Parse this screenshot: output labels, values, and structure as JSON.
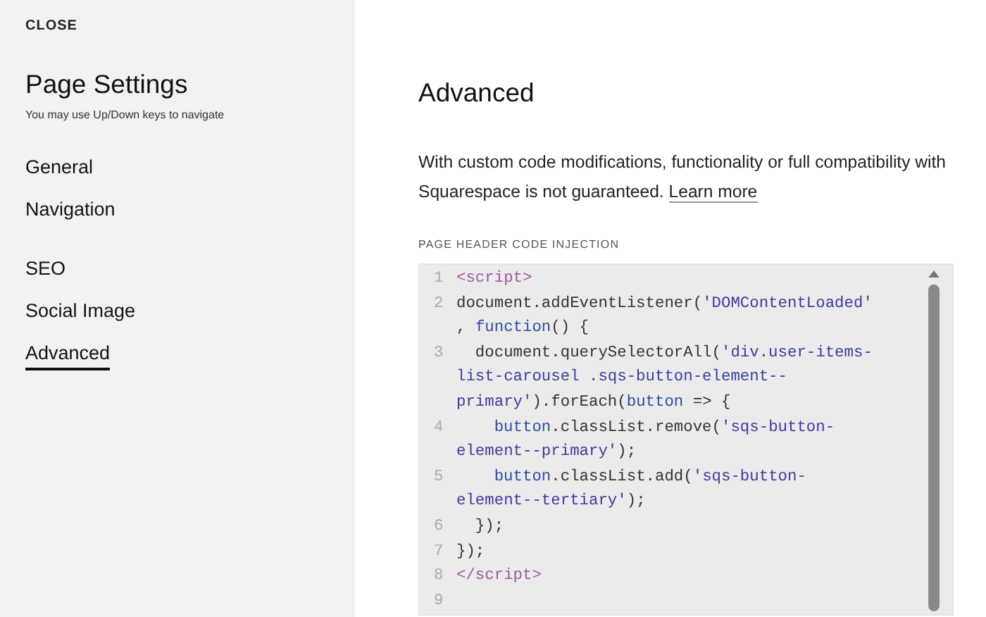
{
  "sidebar": {
    "close": "CLOSE",
    "title": "Page Settings",
    "hint": "You may use Up/Down keys to navigate",
    "groups": [
      [
        {
          "label": "General",
          "selected": false
        },
        {
          "label": "Navigation",
          "selected": false
        }
      ],
      [
        {
          "label": "SEO",
          "selected": false
        },
        {
          "label": "Social Image",
          "selected": false
        },
        {
          "label": "Advanced",
          "selected": true
        }
      ]
    ]
  },
  "main": {
    "title": "Advanced",
    "notice": "With custom code modifications, functionality or full compatibility with Squarespace is not guaranteed.",
    "link": "Learn more",
    "section_label": "PAGE HEADER CODE INJECTION",
    "code": [
      {
        "number": "1",
        "rows": [
          {
            "parts": [
              {
                "kind": "tag",
                "text": "<script>"
              }
            ]
          }
        ]
      },
      {
        "number": "2",
        "rows": [
          {
            "parts": [
              {
                "kind": "plain",
                "text": "document.addEventListener("
              },
              {
                "kind": "string",
                "text": "'DOMContentLoaded'"
              }
            ]
          },
          {
            "parts": [
              {
                "kind": "plain",
                "text": ", "
              },
              {
                "kind": "keyword",
                "text": "function"
              },
              {
                "kind": "plain",
                "text": "() {"
              }
            ]
          }
        ]
      },
      {
        "number": "3",
        "rows": [
          {
            "parts": [
              {
                "kind": "plain",
                "text": "  document.querySelectorAll("
              },
              {
                "kind": "string",
                "text": "'div.user-items-"
              }
            ]
          },
          {
            "parts": [
              {
                "kind": "string",
                "text": "list-carousel .sqs-button-element--"
              }
            ]
          },
          {
            "parts": [
              {
                "kind": "string",
                "text": "primary'"
              },
              {
                "kind": "plain",
                "text": ").forEach("
              },
              {
                "kind": "keyword",
                "text": "button"
              },
              {
                "kind": "plain",
                "text": " => {"
              }
            ]
          }
        ]
      },
      {
        "number": "4",
        "rows": [
          {
            "kind": "indented",
            "parts": [
              {
                "kind": "keyword",
                "text": "button"
              },
              {
                "kind": "plain",
                "text": ".classList.remove("
              },
              {
                "kind": "string",
                "text": "'sqs-button-"
              }
            ]
          },
          {
            "parts": [
              {
                "kind": "string",
                "text": "element--primary'"
              },
              {
                "kind": "plain",
                "text": ");"
              }
            ]
          }
        ]
      },
      {
        "number": "5",
        "rows": [
          {
            "kind": "indented",
            "parts": [
              {
                "kind": "keyword",
                "text": "button"
              },
              {
                "kind": "plain",
                "text": ".classList.add("
              },
              {
                "kind": "string",
                "text": "'sqs-button-"
              }
            ]
          },
          {
            "parts": [
              {
                "kind": "string",
                "text": "element--tertiary'"
              },
              {
                "kind": "plain",
                "text": ");"
              }
            ]
          }
        ]
      },
      {
        "number": "6",
        "rows": [
          {
            "parts": [
              {
                "kind": "plain",
                "text": "  });"
              }
            ]
          }
        ]
      },
      {
        "number": "7",
        "rows": [
          {
            "parts": [
              {
                "kind": "plain",
                "text": "});"
              }
            ]
          }
        ]
      },
      {
        "number": "8",
        "rows": [
          {
            "parts": [
              {
                "kind": "tag",
                "text": "</script>"
              }
            ]
          }
        ]
      },
      {
        "number": "9",
        "rows": [
          {
            "parts": []
          }
        ]
      }
    ]
  }
}
